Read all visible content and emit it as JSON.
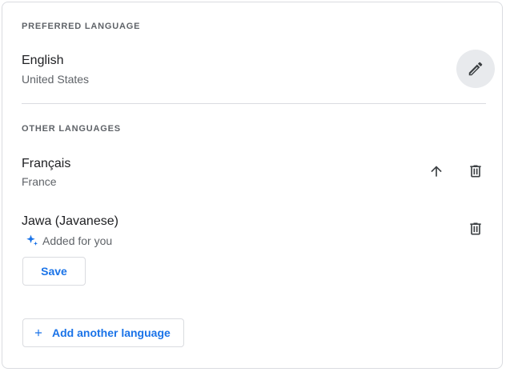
{
  "preferred": {
    "section_label": "PREFERRED LANGUAGE",
    "language": {
      "name": "English",
      "region": "United States"
    },
    "edit_icon": "pencil-icon"
  },
  "other": {
    "section_label": "OTHER LANGUAGES",
    "languages": [
      {
        "name": "Français",
        "region": "France",
        "actions": [
          "arrow-up-icon",
          "trash-icon"
        ]
      },
      {
        "name": "Jawa (Javanese)",
        "note": "Added for you",
        "note_icon": "sparkle-icon",
        "actions": [
          "trash-icon"
        ]
      }
    ]
  },
  "save_label": "Save",
  "add_language_label": "Add another language",
  "colors": {
    "accent": "#1a73e8",
    "text_primary": "#202124",
    "text_secondary": "#5f6368",
    "border": "#dadce0",
    "edit_bg": "#e8eaed"
  }
}
